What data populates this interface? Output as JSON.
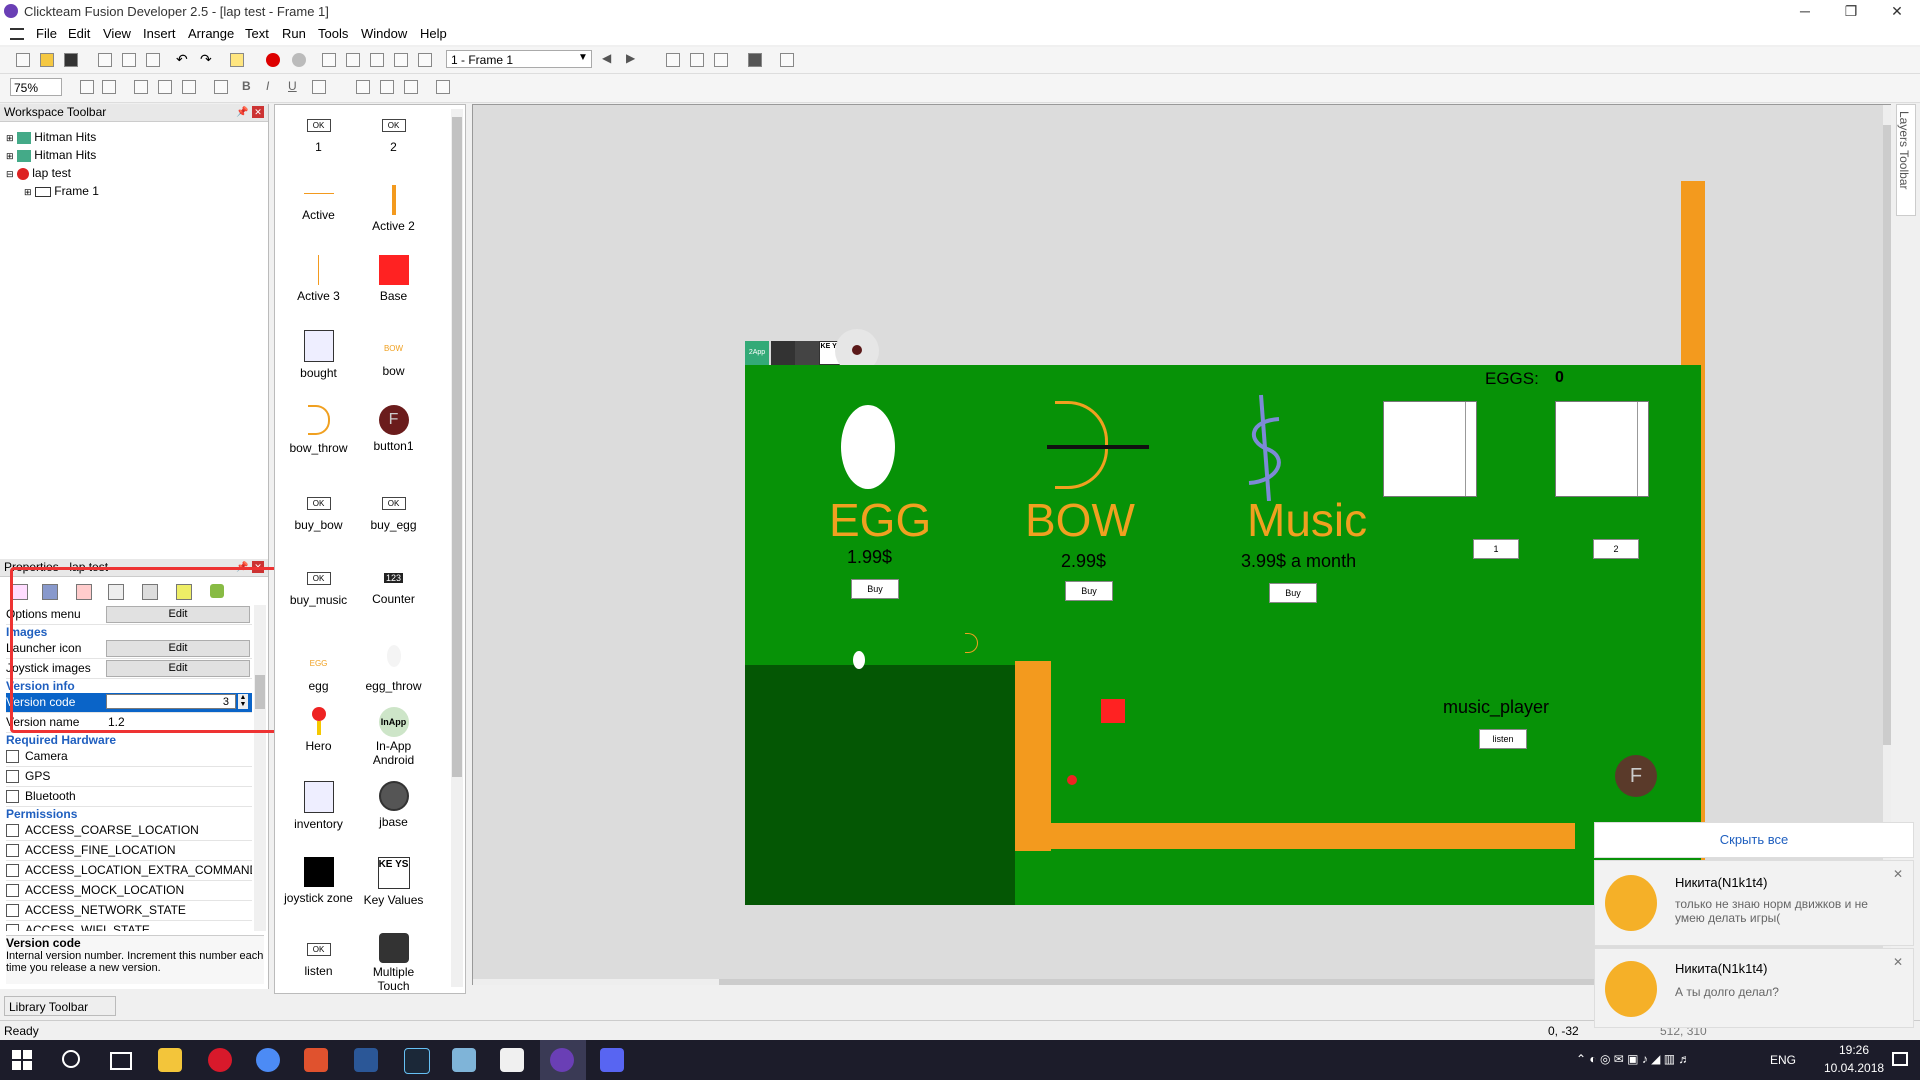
{
  "window": {
    "title": "Clickteam Fusion Developer 2.5 - [lap test - Frame 1]",
    "minimize": "─",
    "maximize": "❐",
    "close": "✕"
  },
  "menu": [
    "File",
    "Edit",
    "View",
    "Insert",
    "Arrange",
    "Text",
    "Run",
    "Tools",
    "Window",
    "Help"
  ],
  "toolbar": {
    "frame_select": "1 - Frame 1",
    "zoom": "75%"
  },
  "workspace": {
    "header": "Workspace Toolbar",
    "items": [
      "Hitman Hits",
      "Hitman Hits",
      "lap test",
      "Frame 1"
    ]
  },
  "properties": {
    "header": "Properties - lap test",
    "rows": {
      "options_menu": "Options menu",
      "edit": "Edit",
      "images_section": "Images",
      "launcher_icon": "Launcher icon",
      "joystick_images": "Joystick images",
      "version_info_section": "Version info",
      "version_code": "Version code",
      "version_code_value": "3",
      "version_name": "Version name",
      "version_name_value": "1.2",
      "required_hardware_section": "Required Hardware",
      "camera": "Camera",
      "gps": "GPS",
      "bluetooth": "Bluetooth",
      "permissions_section": "Permissions",
      "perm1": "ACCESS_COARSE_LOCATION",
      "perm2": "ACCESS_FINE_LOCATION",
      "perm3": "ACCESS_LOCATION_EXTRA_COMMANDS",
      "perm4": "ACCESS_MOCK_LOCATION",
      "perm5": "ACCESS_NETWORK_STATE",
      "perm6": "ACCESS_WIFI_STATE"
    },
    "help_title": "Version code",
    "help_text": "Internal version number. Increment this number each time you release a new version."
  },
  "library_tab": "Library Toolbar",
  "objects": {
    "o1": "1",
    "o2": "2",
    "active": "Active",
    "active2": "Active 2",
    "active3": "Active 3",
    "base": "Base",
    "bought": "bought",
    "bow": "bow",
    "bow_throw": "bow_throw",
    "button1": "button1",
    "buy_bow": "buy_bow",
    "buy_egg": "buy_egg",
    "buy_music": "buy_music",
    "counter": "Counter",
    "egg": "egg",
    "egg_throw": "egg_throw",
    "hero": "Hero",
    "inapp": "In-App Android",
    "inventory": "inventory",
    "jbase": "jbase",
    "joystick_zone": "joystick zone",
    "key_values": "Key Values",
    "listen": "listen",
    "multiple_touch": "Multiple Touch",
    "ok": "OK",
    "counter_icon": "123",
    "keys_icon": "KE YS",
    "egg_icon": "EGG",
    "bow_icon": "BOW",
    "f_icon": "F",
    "inapp_icon": "InApp"
  },
  "frame": {
    "eggs_label": "EGGS:",
    "eggs_value": "0",
    "egg_title": "EGG",
    "egg_price": "1.99$",
    "bow_title": "BOW",
    "bow_price": "2.99$",
    "music_title": "Music",
    "music_price": "3.99$ a month",
    "buy": "Buy",
    "slot1": "1",
    "slot2": "2",
    "music_player": "music_player",
    "listen": "listen",
    "f_button": "F",
    "top_icon_text": "2App",
    "keys_text": "KE YS"
  },
  "layers_toolbar": "Layers Toolbar",
  "status": {
    "ready": "Ready",
    "coords": "0, -32",
    "coords2": "512, 310"
  },
  "notifications": {
    "hide_all": "Скрыть все",
    "n1_name": "Никита(N1k1t4)",
    "n1_text": "только не знаю норм движков и не умею делать игры(",
    "n2_name": "Никита(N1k1t4)",
    "n2_text": "А ты долго делал?"
  },
  "taskbar": {
    "lang": "ENG",
    "time": "19:26",
    "date": "10.04.2018"
  }
}
